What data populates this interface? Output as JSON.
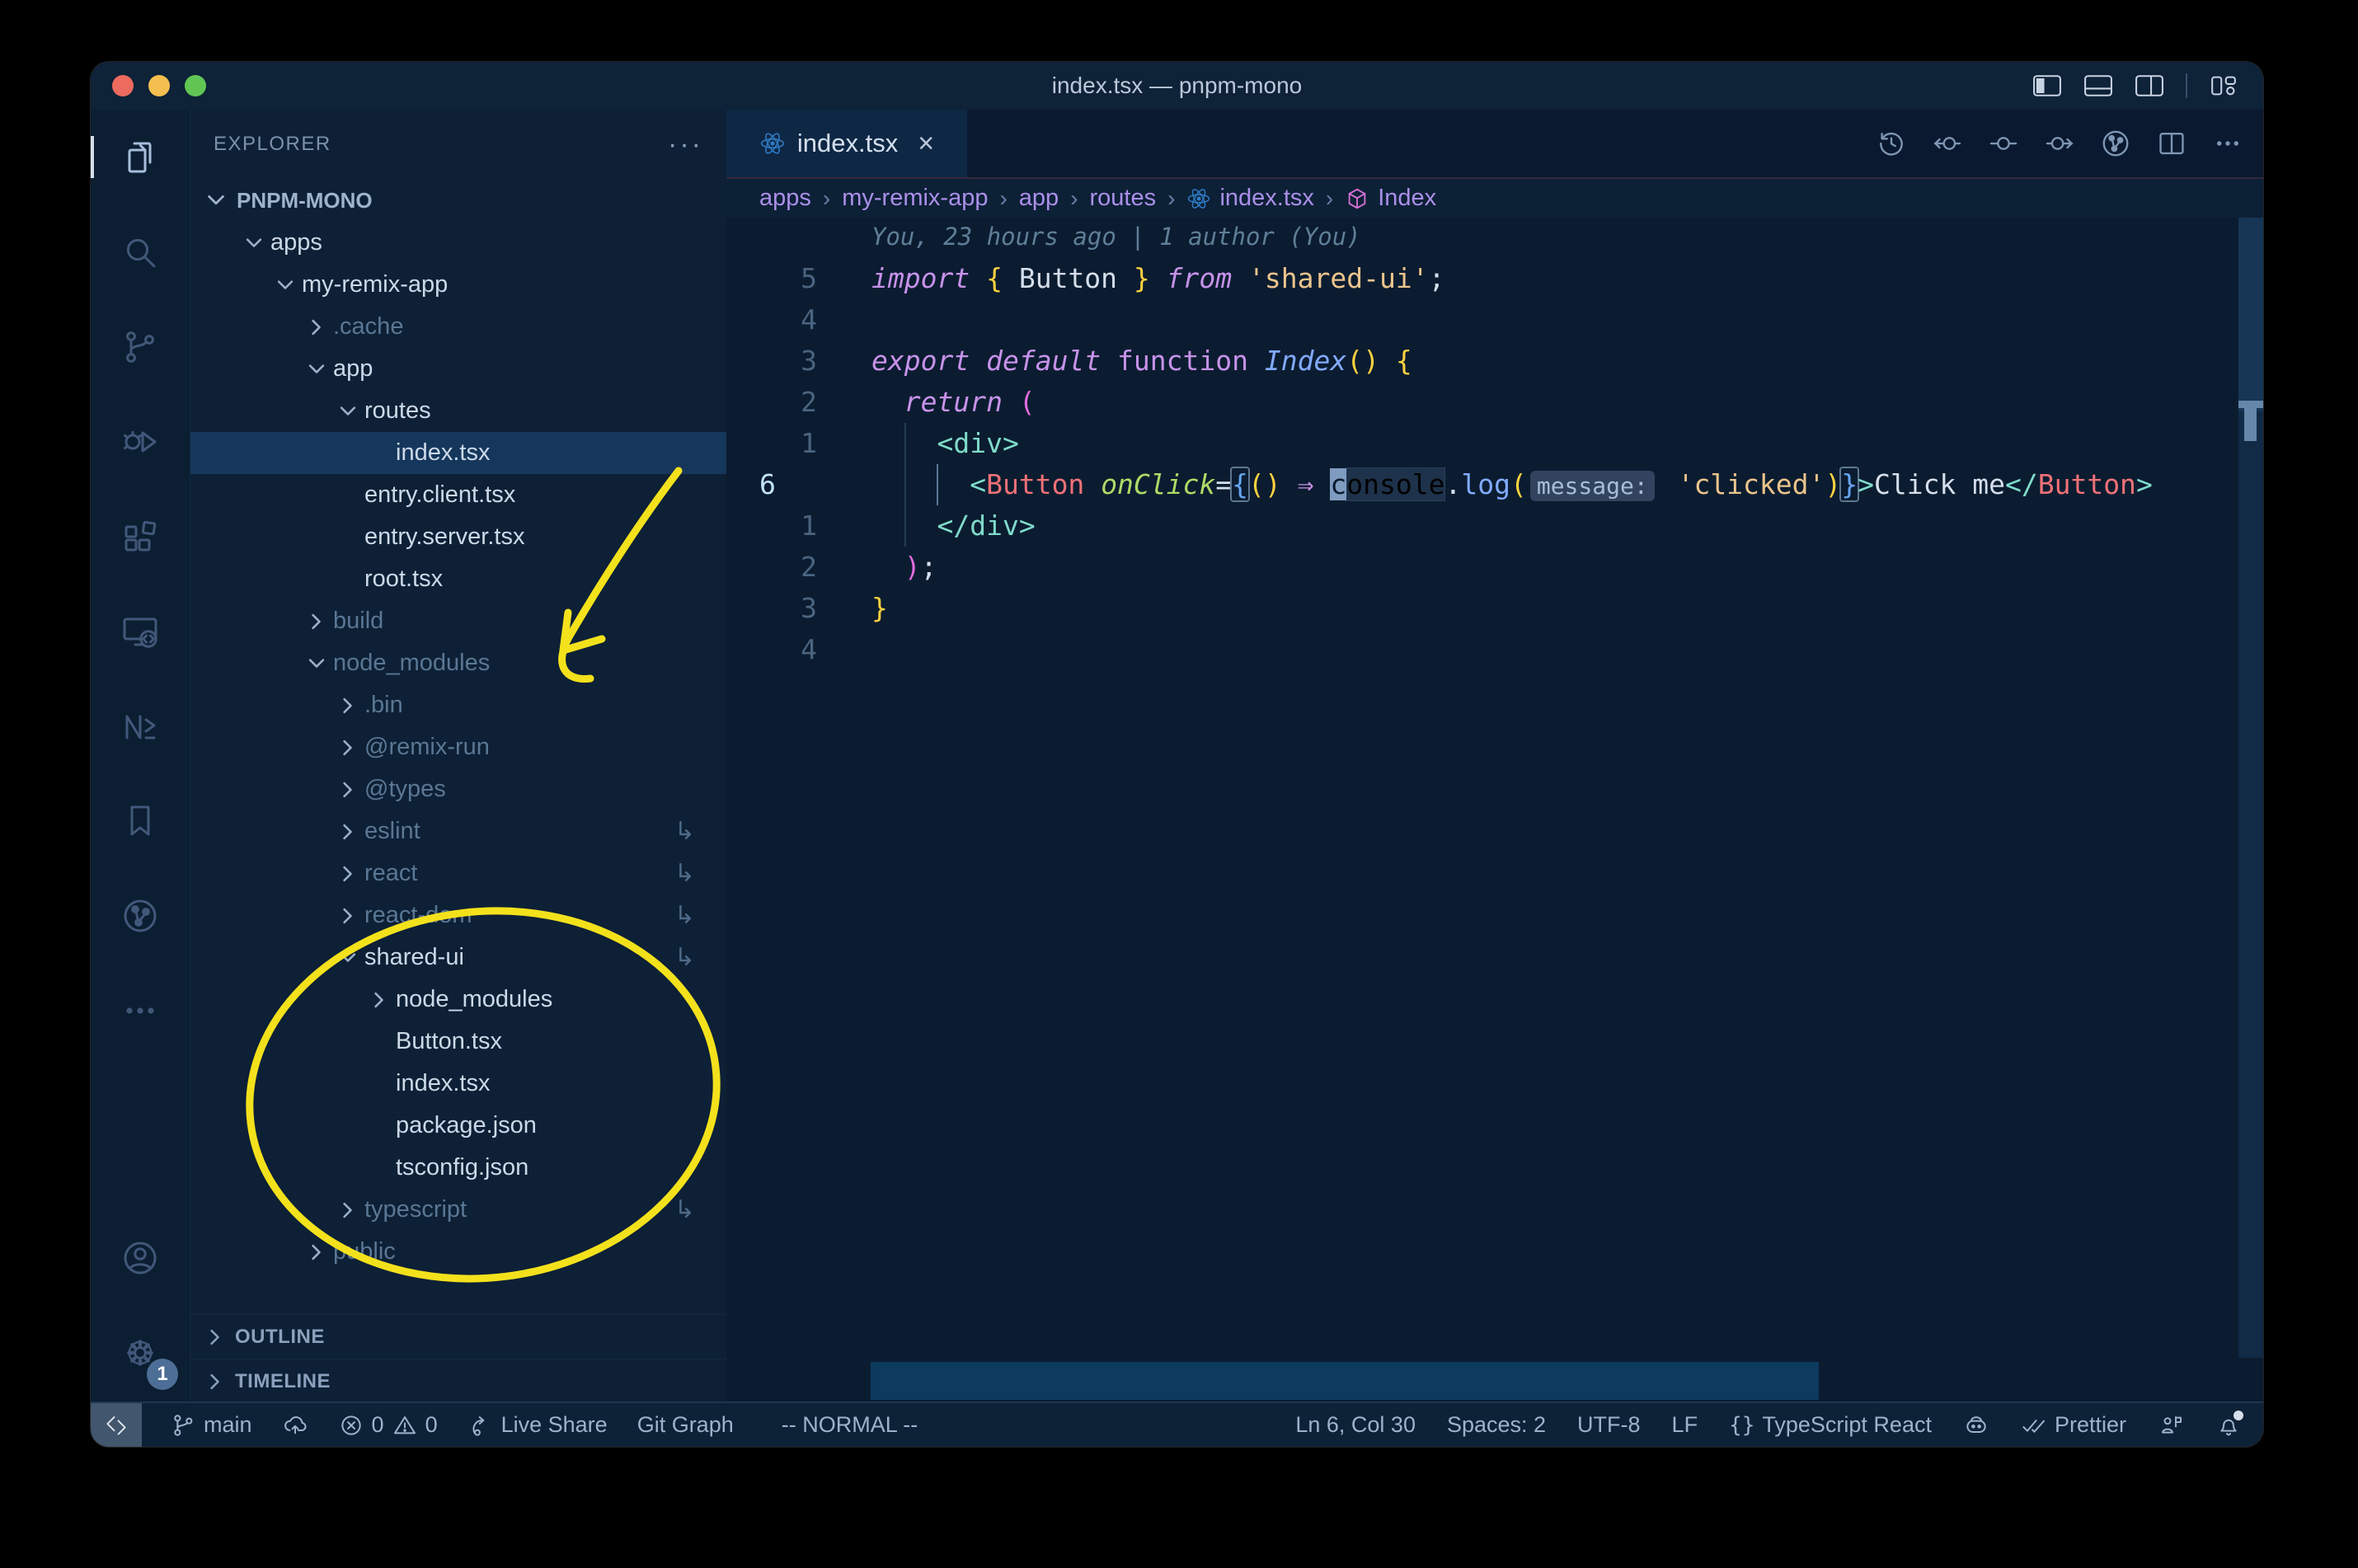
{
  "window": {
    "title": "index.tsx — pnpm-mono"
  },
  "titlebar": {
    "layout_icons": [
      "layout-sidebar-icon",
      "layout-panel-icon",
      "layout-split-icon",
      "customize-layout-icon"
    ]
  },
  "activity_bar": {
    "top": [
      {
        "name": "explorer",
        "active": true
      },
      {
        "name": "search"
      },
      {
        "name": "source-control"
      },
      {
        "name": "run-debug"
      },
      {
        "name": "extensions"
      },
      {
        "name": "remote-explorer"
      },
      {
        "name": "nx-console"
      },
      {
        "name": "bookmarks"
      },
      {
        "name": "git-graph"
      },
      {
        "name": "more"
      }
    ],
    "bottom": [
      {
        "name": "account"
      },
      {
        "name": "settings",
        "badge": "1"
      }
    ]
  },
  "sidebar": {
    "header": "EXPLORER",
    "header_more": "···",
    "section": "PNPM-MONO",
    "tree": [
      {
        "depth": 1,
        "chevron": "down",
        "icon": "folder-open",
        "label": "apps"
      },
      {
        "depth": 2,
        "chevron": "down",
        "icon": "folder-open",
        "label": "my-remix-app"
      },
      {
        "depth": 3,
        "chevron": "right",
        "icon": "folder",
        "label": ".cache",
        "dim": true
      },
      {
        "depth": 3,
        "chevron": "down",
        "icon": "folder-app",
        "label": "app"
      },
      {
        "depth": 4,
        "chevron": "down",
        "icon": "folder-routes",
        "label": "routes"
      },
      {
        "depth": 5,
        "chevron": null,
        "icon": "react",
        "label": "index.tsx",
        "selected": true
      },
      {
        "depth": 4,
        "chevron": null,
        "icon": "react",
        "label": "entry.client.tsx"
      },
      {
        "depth": 4,
        "chevron": null,
        "icon": "react",
        "label": "entry.server.tsx"
      },
      {
        "depth": 4,
        "chevron": null,
        "icon": "react",
        "label": "root.tsx"
      },
      {
        "depth": 3,
        "chevron": "right",
        "icon": "folder-build",
        "label": "build",
        "dim": true
      },
      {
        "depth": 3,
        "chevron": "down",
        "icon": "folder-nm",
        "label": "node_modules",
        "dim": true
      },
      {
        "depth": 4,
        "chevron": "right",
        "icon": "folder-bin",
        "label": ".bin",
        "dim": true
      },
      {
        "depth": 4,
        "chevron": "right",
        "icon": "folder",
        "label": "@remix-run",
        "dim": true
      },
      {
        "depth": 4,
        "chevron": "right",
        "icon": "folder-types",
        "label": "@types",
        "dim": true
      },
      {
        "depth": 4,
        "chevron": "right",
        "icon": "folder",
        "label": "eslint",
        "dim": true,
        "symlink": true
      },
      {
        "depth": 4,
        "chevron": "right",
        "icon": "folder",
        "label": "react",
        "dim": true,
        "symlink": true
      },
      {
        "depth": 4,
        "chevron": "right",
        "icon": "folder",
        "label": "react-dom",
        "dim": true,
        "symlink": true
      },
      {
        "depth": 4,
        "chevron": "down",
        "icon": "folder-open",
        "label": "shared-ui",
        "symlink": true
      },
      {
        "depth": 5,
        "chevron": "right",
        "icon": "folder-nm",
        "label": "node_modules"
      },
      {
        "depth": 5,
        "chevron": null,
        "icon": "react",
        "label": "Button.tsx"
      },
      {
        "depth": 5,
        "chevron": null,
        "icon": "react",
        "label": "index.tsx"
      },
      {
        "depth": 5,
        "chevron": null,
        "icon": "npm",
        "label": "package.json"
      },
      {
        "depth": 5,
        "chevron": null,
        "icon": "tsconfig",
        "label": "tsconfig.json"
      },
      {
        "depth": 4,
        "chevron": "right",
        "icon": "folder-ts",
        "label": "typescript",
        "dim": true,
        "symlink": true
      },
      {
        "depth": 3,
        "chevron": "right",
        "icon": "folder-public",
        "label": "public",
        "dim": true
      }
    ],
    "bottom_sections": [
      "OUTLINE",
      "TIMELINE"
    ]
  },
  "tabs": [
    {
      "label": "index.tsx",
      "icon": "react",
      "close": "×",
      "active": true
    }
  ],
  "editor_actions": [
    "timeline-clock-icon",
    "nav-back-icon",
    "nav-circle-icon",
    "nav-forward-icon",
    "git-graph-icon",
    "split-editor-icon",
    "ellipsis-icon"
  ],
  "breadcrumbs": {
    "separator": "›",
    "items": [
      {
        "label": "apps"
      },
      {
        "label": "my-remix-app"
      },
      {
        "label": "app"
      },
      {
        "label": "routes"
      },
      {
        "label": "index.tsx",
        "icon": "react"
      },
      {
        "label": "Index",
        "icon": "symbol-cube"
      }
    ]
  },
  "editor": {
    "blame": "You, 23 hours ago | 1 author (You)",
    "lines": [
      {
        "num": "5",
        "tokens": [
          [
            "kw",
            "import"
          ],
          [
            "w",
            " "
          ],
          [
            "y",
            "{"
          ],
          [
            "w",
            " Button "
          ],
          [
            "y",
            "}"
          ],
          [
            "w",
            " "
          ],
          [
            "kw",
            "from"
          ],
          [
            "w",
            " "
          ],
          [
            "str",
            "'shared-ui'"
          ],
          [
            "w",
            ";"
          ]
        ]
      },
      {
        "num": "4",
        "tokens": []
      },
      {
        "num": "3",
        "tokens": [
          [
            "kw",
            "export"
          ],
          [
            "w",
            " "
          ],
          [
            "kw",
            "default"
          ],
          [
            "w",
            " "
          ],
          [
            "kwu",
            "function"
          ],
          [
            "w",
            " "
          ],
          [
            "fn",
            "Index"
          ],
          [
            "y",
            "()"
          ],
          [
            "w",
            " "
          ],
          [
            "y",
            "{"
          ]
        ]
      },
      {
        "num": "2",
        "tokens": [
          [
            "w",
            "  "
          ],
          [
            "kw",
            "return"
          ],
          [
            "w",
            " "
          ],
          [
            "p",
            "("
          ]
        ]
      },
      {
        "num": "1",
        "tokens": [
          [
            "w",
            "    "
          ],
          [
            "tag",
            "<div>"
          ]
        ]
      },
      {
        "num": "6",
        "current": true,
        "tokens": [
          [
            "w",
            "      "
          ],
          [
            "tag",
            "<"
          ],
          [
            "cmp",
            "Button"
          ],
          [
            "w",
            " "
          ],
          [
            "attr",
            "onClick"
          ],
          [
            "w",
            "="
          ],
          [
            "bl box",
            "{"
          ],
          [
            "y",
            "()"
          ],
          [
            "w",
            " "
          ],
          [
            "arr",
            "⇒"
          ],
          [
            "w",
            " "
          ],
          [
            "cursor",
            "c"
          ],
          [
            "whl",
            "onsole"
          ],
          [
            "w",
            "."
          ],
          [
            "fnc",
            "log"
          ],
          [
            "y",
            "("
          ],
          [
            "inlay",
            "message:"
          ],
          [
            "w",
            " "
          ],
          [
            "str",
            "'clicked'"
          ],
          [
            "y",
            ")"
          ],
          [
            "bl box",
            "}"
          ],
          [
            "tag",
            ">"
          ],
          [
            "w",
            "Click me"
          ],
          [
            "tag",
            "</"
          ],
          [
            "cmp",
            "Button"
          ],
          [
            "tag",
            ">"
          ]
        ]
      },
      {
        "num": "1",
        "tokens": [
          [
            "w",
            "    "
          ],
          [
            "tag",
            "</div>"
          ]
        ]
      },
      {
        "num": "2",
        "tokens": [
          [
            "w",
            "  "
          ],
          [
            "p",
            ")"
          ],
          [
            "w",
            ";"
          ]
        ]
      },
      {
        "num": "3",
        "tokens": [
          [
            "y",
            "}"
          ]
        ]
      },
      {
        "num": "4",
        "tokens": []
      }
    ]
  },
  "status_bar": {
    "left": [
      {
        "icon": "git-branch",
        "label": "main"
      },
      {
        "icon": "cloud-upload",
        "label": ""
      },
      {
        "icon": "error-circle",
        "label": "0",
        "icon2": "warning-triangle",
        "label2": "0"
      },
      {
        "icon": "live-share",
        "label": "Live Share"
      },
      {
        "icon": null,
        "label": "Git Graph"
      },
      {
        "icon": null,
        "label": "-- NORMAL --"
      }
    ],
    "right": [
      {
        "icon": null,
        "label": "Ln 6, Col 30"
      },
      {
        "icon": null,
        "label": "Spaces: 2"
      },
      {
        "icon": null,
        "label": "UTF-8"
      },
      {
        "icon": null,
        "label": "LF"
      },
      {
        "icon": "braces",
        "label": "TypeScript React"
      },
      {
        "icon": "copilot",
        "label": ""
      },
      {
        "icon": "double-check",
        "label": "Prettier"
      },
      {
        "icon": "feedback",
        "label": ""
      },
      {
        "icon": "bell",
        "label": "",
        "dot": true
      }
    ]
  },
  "colors": {
    "annotation_yellow": "#f3e11c",
    "react_blue": "#2e7bc4",
    "folder_tan": "#d8ab6c",
    "accent_purple": "#ab8fe8",
    "selection_row": "#16375c",
    "traffic": [
      "#ed6a5e",
      "#f4bf4f",
      "#61c554"
    ]
  }
}
